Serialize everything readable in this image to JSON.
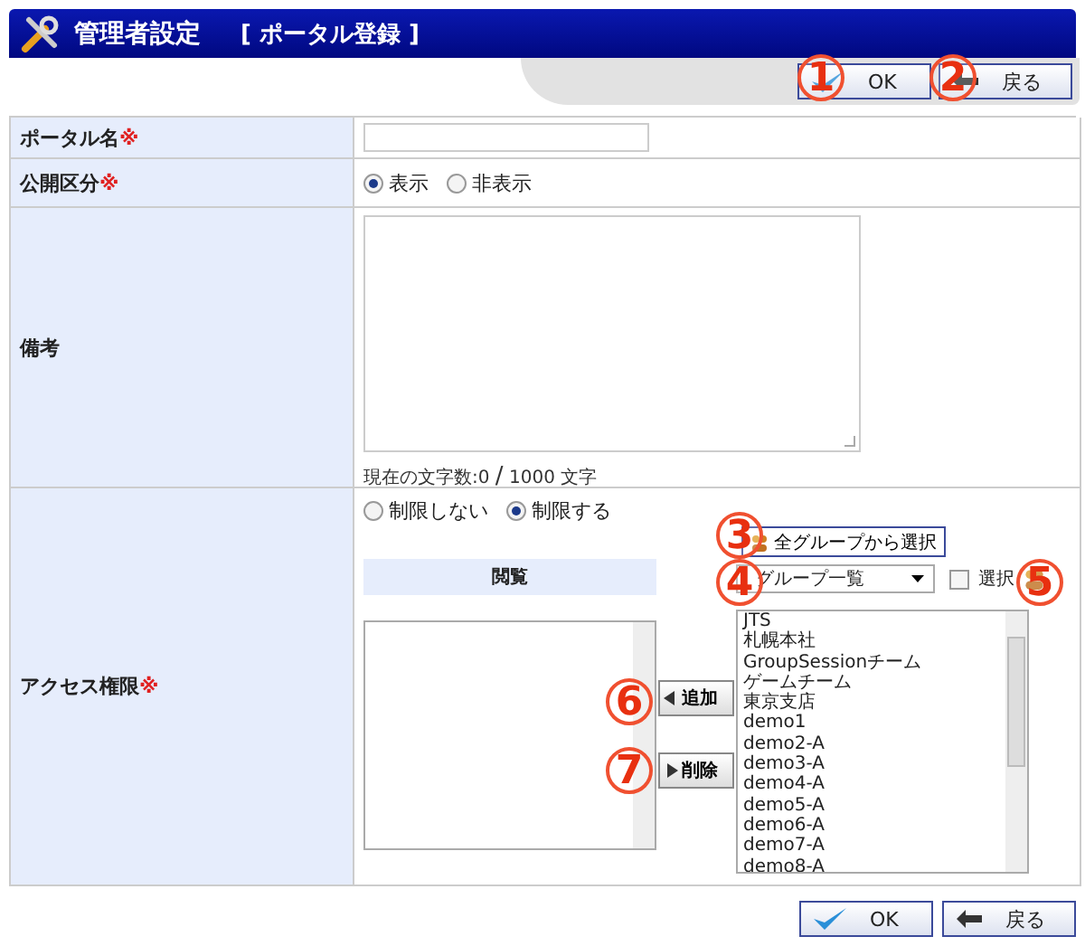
{
  "header": {
    "title": "管理者設定",
    "subtitle": "[ ポータル登録 ]"
  },
  "top_buttons": [
    {
      "kind": "ok",
      "label": "OK"
    },
    {
      "kind": "back",
      "label": "戻る"
    }
  ],
  "form": {
    "name": {
      "label": "ポータル名",
      "required_mark": "※"
    },
    "visibility": {
      "label": "公開区分",
      "required_mark": "※",
      "options": [
        {
          "label": "表示",
          "selected": true
        },
        {
          "label": "非表示",
          "selected": false
        }
      ]
    },
    "notes": {
      "label": "備考",
      "counter_prefix": "現在の文字数:0",
      "counter_slash": "/",
      "counter_suffix": "1000 文字"
    },
    "access": {
      "label": "アクセス権限",
      "required_mark": "※",
      "options": [
        {
          "label": "制限しない",
          "selected": false
        },
        {
          "label": "制限する",
          "selected": true
        }
      ],
      "all_groups_button": "全グループから選択",
      "view_header": "閲覧",
      "group_dropdown": "グループ一覧",
      "select_checkbox": {
        "label": "選択",
        "checked": false
      },
      "add_button": "追加",
      "delete_button": "削除",
      "group_list": [
        "JTS",
        "札幌本社",
        "GroupSessionチーム",
        "ゲームチーム",
        "東京支店",
        "demo1",
        "demo2-A",
        "demo3-A",
        "demo4-A",
        "demo5-A",
        "demo6-A",
        "demo7-A",
        "demo8-A"
      ]
    }
  },
  "bottom_buttons": [
    {
      "kind": "ok",
      "label": "OK"
    },
    {
      "kind": "back",
      "label": "戻る"
    }
  ],
  "callouts": [
    "1",
    "2",
    "3",
    "4",
    "5",
    "6",
    "7"
  ]
}
